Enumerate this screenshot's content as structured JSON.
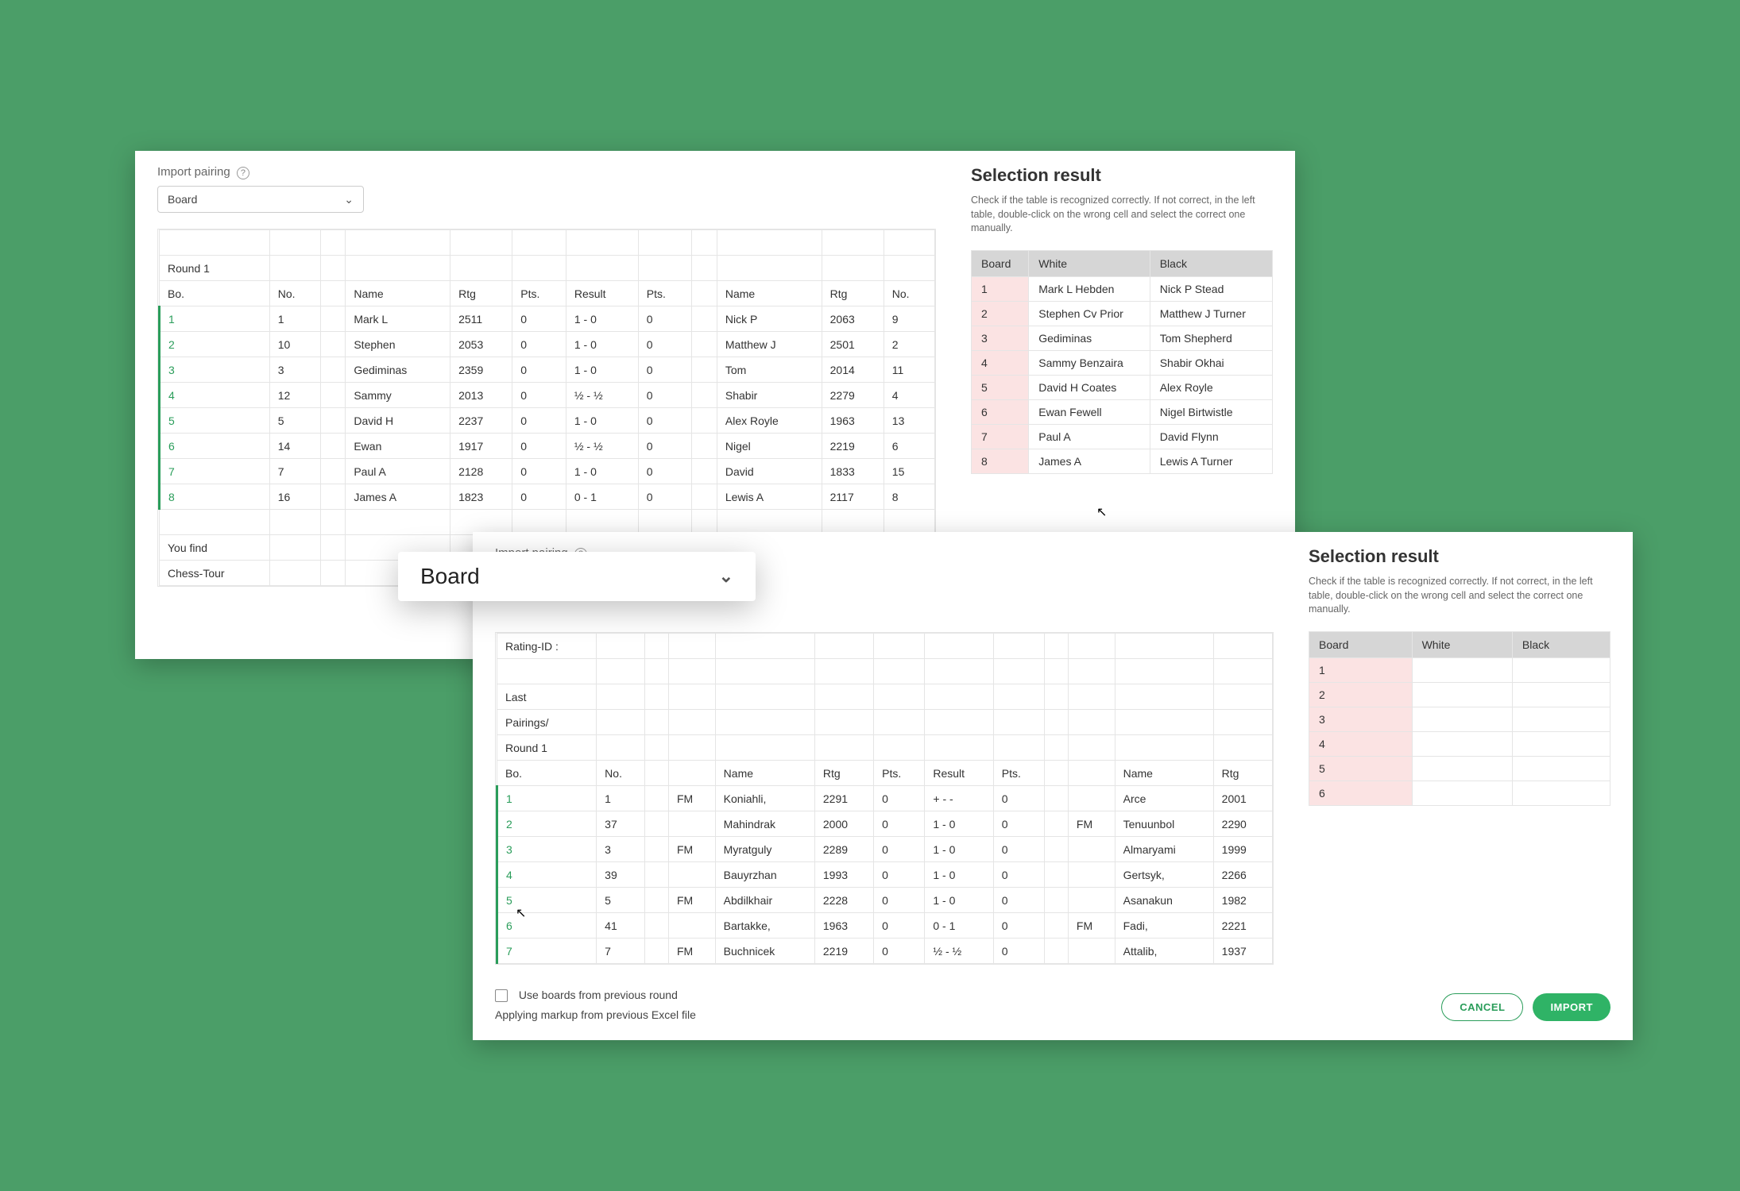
{
  "panelA": {
    "import_label": "Import pairing",
    "select_value": "Board",
    "headers": [
      "Bo.",
      "No.",
      "",
      "Name",
      "Rtg",
      "Pts.",
      "Result",
      "Pts.",
      "",
      "Name",
      "Rtg",
      "No."
    ],
    "pre_rows": [
      [
        "",
        " ",
        " ",
        " ",
        " ",
        " ",
        " ",
        " ",
        " ",
        " ",
        " ",
        " "
      ],
      [
        "Round 1",
        " ",
        " ",
        " ",
        " ",
        " ",
        " ",
        " ",
        " ",
        " ",
        " ",
        " "
      ]
    ],
    "rows": [
      [
        "1",
        "1",
        "",
        "Mark L",
        "2511",
        "0",
        "1 - 0",
        "0",
        "",
        "Nick P",
        "2063",
        "9"
      ],
      [
        "2",
        "10",
        "",
        "Stephen",
        "2053",
        "0",
        "1 - 0",
        "0",
        "",
        "Matthew J",
        "2501",
        "2"
      ],
      [
        "3",
        "3",
        "",
        "Gediminas",
        "2359",
        "0",
        "1 - 0",
        "0",
        "",
        "Tom",
        "2014",
        "11"
      ],
      [
        "4",
        "12",
        "",
        "Sammy",
        "2013",
        "0",
        "½ - ½",
        "0",
        "",
        "Shabir",
        "2279",
        "4"
      ],
      [
        "5",
        "5",
        "",
        "David H",
        "2237",
        "0",
        "1 - 0",
        "0",
        "",
        "Alex Royle",
        "1963",
        "13"
      ],
      [
        "6",
        "14",
        "",
        "Ewan",
        "1917",
        "0",
        "½ - ½",
        "0",
        "",
        "Nigel",
        "2219",
        "6"
      ],
      [
        "7",
        "7",
        "",
        "Paul A",
        "2128",
        "0",
        "1 - 0",
        "0",
        "",
        "David",
        "1833",
        "15"
      ],
      [
        "8",
        "16",
        "",
        "James A",
        "1823",
        "0",
        "0 - 1",
        "0",
        "",
        "Lewis A",
        "2117",
        "8"
      ]
    ],
    "post_rows": [
      [
        "",
        "",
        "",
        "",
        "",
        "",
        "",
        "",
        "",
        "",
        "",
        ""
      ],
      [
        "You find",
        "",
        "",
        "",
        "",
        "",
        "",
        "",
        "",
        "",
        "",
        ""
      ],
      [
        "Chess-Tour",
        "",
        "",
        "",
        "",
        "",
        "",
        "",
        "",
        "",
        "",
        ""
      ]
    ],
    "sel_title": "Selection result",
    "sel_sub": "Check if the table is recognized correctly. If not correct, in the left table, double-click on the wrong cell and select the correct one manually.",
    "sel_headers": [
      "Board",
      "White",
      "Black"
    ],
    "sel_rows": [
      [
        "1",
        "Mark L Hebden",
        "Nick P Stead"
      ],
      [
        "2",
        "Stephen Cv Prior",
        "Matthew J Turner"
      ],
      [
        "3",
        "Gediminas",
        "Tom Shepherd"
      ],
      [
        "4",
        "Sammy Benzaira",
        "Shabir Okhai"
      ],
      [
        "5",
        "David H Coates",
        "Alex Royle"
      ],
      [
        "6",
        "Ewan Fewell",
        "Nigel Birtwistle"
      ],
      [
        "7",
        "Paul A",
        "David Flynn"
      ],
      [
        "8",
        "James A",
        "Lewis A Turner"
      ]
    ]
  },
  "panelB": {
    "import_label": "Import pairing",
    "select_value": "Board",
    "headers": [
      "Bo.",
      "No.",
      "",
      "",
      "Name",
      "Rtg",
      "Pts.",
      "Result",
      "Pts.",
      "",
      "",
      "Name",
      "Rtg"
    ],
    "pre_rows": [
      [
        "Rating-ID :",
        "",
        "",
        "",
        "",
        "",
        "",
        "",
        "",
        "",
        "",
        "",
        ""
      ],
      [
        "",
        "",
        "",
        "",
        "",
        "",
        "",
        "",
        "",
        "",
        "",
        "",
        ""
      ],
      [
        "Last",
        "",
        "",
        "",
        "",
        "",
        "",
        "",
        "",
        "",
        "",
        "",
        ""
      ],
      [
        "Pairings/",
        "",
        "",
        "",
        "",
        "",
        "",
        "",
        "",
        "",
        "",
        "",
        ""
      ],
      [
        "Round 1",
        "",
        "",
        "",
        "",
        "",
        "",
        "",
        "",
        "",
        "",
        "",
        ""
      ]
    ],
    "rows": [
      [
        "1",
        "1",
        "",
        "FM",
        "Koniahli,",
        "2291",
        "0",
        "+ - -",
        "0",
        "",
        "",
        "Arce",
        "2001"
      ],
      [
        "2",
        "37",
        "",
        "",
        "Mahindrak",
        "2000",
        "0",
        "1 - 0",
        "0",
        "",
        "FM",
        "Tenuunbol",
        "2290"
      ],
      [
        "3",
        "3",
        "",
        "FM",
        "Myratguly",
        "2289",
        "0",
        "1 - 0",
        "0",
        "",
        "",
        "Almaryami",
        "1999"
      ],
      [
        "4",
        "39",
        "",
        "",
        "Bauyrzhan",
        "1993",
        "0",
        "1 - 0",
        "0",
        "",
        "",
        "Gertsyk,",
        "2266"
      ],
      [
        "5",
        "5",
        "",
        "FM",
        "Abdilkhair",
        "2228",
        "0",
        "1 - 0",
        "0",
        "",
        "",
        "Asanakun",
        "1982"
      ],
      [
        "6",
        "41",
        "",
        "",
        "Bartakke,",
        "1963",
        "0",
        "0 - 1",
        "0",
        "",
        "FM",
        "Fadi,",
        "2221"
      ],
      [
        "7",
        "7",
        "",
        "FM",
        "Buchnicek",
        "2219",
        "0",
        "½ - ½",
        "0",
        "",
        "",
        "Attalib,",
        "1937"
      ]
    ],
    "sel_title": "Selection result",
    "sel_sub": "Check if the table is recognized correctly. If not correct, in the left table, double-click on the wrong cell and select the correct one manually.",
    "sel_headers": [
      "Board",
      "White",
      "Black"
    ],
    "sel_rows": [
      [
        "1",
        "",
        ""
      ],
      [
        "2",
        "",
        ""
      ],
      [
        "3",
        "",
        ""
      ],
      [
        "4",
        "",
        ""
      ],
      [
        "5",
        "",
        ""
      ],
      [
        "6",
        "",
        ""
      ]
    ],
    "checkbox_label": "Use boards from previous round",
    "applying_label": "Applying markup from previous Excel file",
    "cancel_label": "CANCEL",
    "import_btn_label": "IMPORT"
  }
}
